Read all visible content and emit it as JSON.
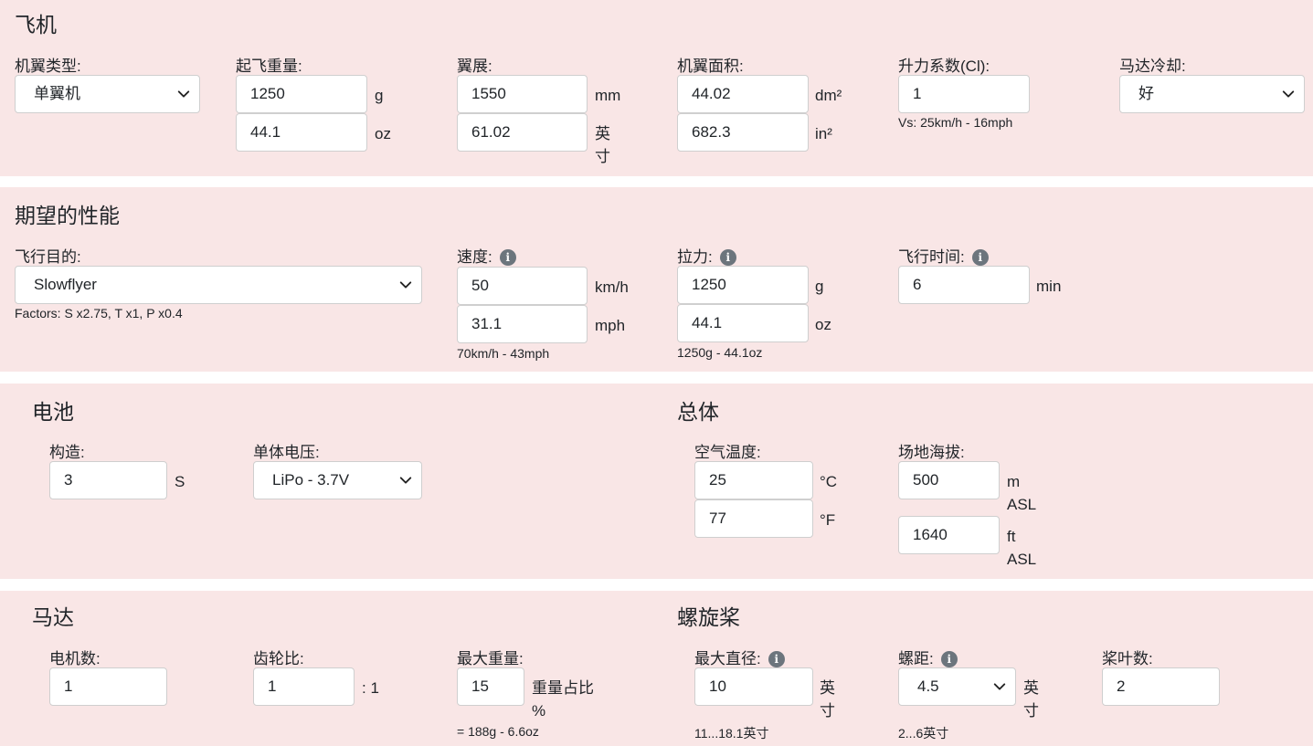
{
  "aircraft": {
    "title": "飞机",
    "wing_type": {
      "label": "机翼类型:",
      "value": "单翼机"
    },
    "weight": {
      "label": "起飞重量:",
      "value_g": "1250",
      "unit_g": "g",
      "value_oz": "44.1",
      "unit_oz": "oz"
    },
    "span": {
      "label": "翼展:",
      "value_mm": "1550",
      "unit_mm": "mm",
      "value_in": "61.02",
      "unit_in": "英寸"
    },
    "area": {
      "label": "机翼面积:",
      "value_dm2": "44.02",
      "unit_dm2": "dm²",
      "value_in2": "682.3",
      "unit_in2": "in²"
    },
    "lift": {
      "label": "升力系数(Cl):",
      "value": "1",
      "hint": "Vs: 25km/h - 16mph"
    },
    "cooling": {
      "label": "马达冷却:",
      "value": "好"
    }
  },
  "performance": {
    "title": "期望的性能",
    "purpose": {
      "label": "飞行目的:",
      "value": "Slowflyer",
      "hint": "Factors: S x2.75, T x1, P x0.4"
    },
    "speed": {
      "label": "速度:",
      "value_kmh": "50",
      "unit_kmh": "km/h",
      "value_mph": "31.1",
      "unit_mph": "mph",
      "hint": "70km/h - 43mph"
    },
    "thrust": {
      "label": "拉力:",
      "value_g": "1250",
      "unit_g": "g",
      "value_oz": "44.1",
      "unit_oz": "oz",
      "hint": "1250g - 44.1oz"
    },
    "flight_time": {
      "label": "飞行时间:",
      "value": "6",
      "unit": "min"
    }
  },
  "battery": {
    "title": "电池",
    "config": {
      "label": "构造:",
      "value": "3",
      "unit": "S"
    },
    "cell_voltage": {
      "label": "单体电压:",
      "value": "LiPo - 3.7V"
    }
  },
  "general": {
    "title": "总体",
    "air_temp": {
      "label": "空气温度:",
      "value_c": "25",
      "unit_c": "°C",
      "value_f": "77",
      "unit_f": "°F"
    },
    "elevation": {
      "label": "场地海拔:",
      "value_m": "500",
      "unit_m_1": "m",
      "unit_m_2": "ASL",
      "value_ft": "1640",
      "unit_ft_1": "ft",
      "unit_ft_2": "ASL"
    }
  },
  "motor": {
    "title": "马达",
    "count": {
      "label": "电机数:",
      "value": "1"
    },
    "gear": {
      "label": "齿轮比:",
      "value": "1",
      "suffix": ": 1"
    },
    "max_weight": {
      "label": "最大重量:",
      "value": "15",
      "unit_1": "重量占比",
      "unit_2": "%",
      "hint": "= 188g - 6.6oz"
    }
  },
  "propeller": {
    "title": "螺旋桨",
    "diameter": {
      "label": "最大直径:",
      "value": "10",
      "unit": "英寸",
      "hint": "11...18.1英寸"
    },
    "pitch": {
      "label": "螺距:",
      "value": "4.5",
      "unit": "英寸",
      "hint": "2...6英寸"
    },
    "blades": {
      "label": "桨叶数:",
      "value": "2"
    }
  },
  "icons": {
    "info": "i",
    "chevron": "chevron-down-icon"
  }
}
